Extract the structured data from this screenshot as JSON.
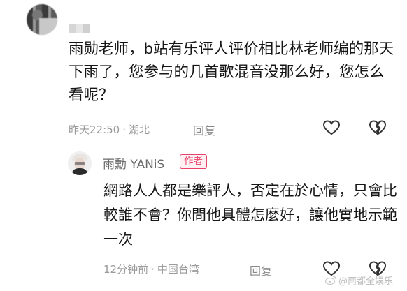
{
  "comment": {
    "text": "雨勋老师，b站有乐评人评价相比林老师编的那天下雨了，您参与的几首歌混音没那么好，您怎么看呢？",
    "time": "昨天22:50",
    "location": "湖北",
    "reply_label": "回复",
    "icons": [
      "heart-outline-icon",
      "broken-heart-icon"
    ]
  },
  "reply": {
    "author": "雨勳 YANiS",
    "badge": "作者",
    "text": "網路人人都是樂評人，否定在於心情，只會比較誰不會？你問他具體怎麼好，讓他實地示範一次",
    "time": "12分钟前",
    "location": "中国台湾",
    "reply_label": "回复",
    "icons": [
      "heart-outline-icon",
      "broken-heart-icon"
    ]
  },
  "watermark": {
    "text": "@南都全娱乐"
  },
  "separator": "·",
  "colors": {
    "meta": "#9a9a9a",
    "badge": "#e8426a"
  }
}
